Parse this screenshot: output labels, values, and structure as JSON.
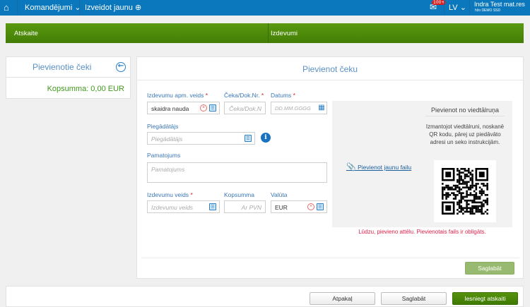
{
  "nav": {
    "menu1": "Komandējumi",
    "menu2": "Izveidot jaunu",
    "badge": "100+",
    "lang": "LV",
    "user_name": "Indra Test mat.res",
    "user_org": "hžo DEMO SSD"
  },
  "steps": [
    "Atskaite",
    "Izdevumi"
  ],
  "left": {
    "title": "Pievienotie čeki",
    "total": "Kopsumma: 0,00 EUR"
  },
  "form": {
    "title": "Pievienot čeku",
    "pay_type_label": "Izdevumu apm. veids",
    "pay_type_value": "skaidra nauda",
    "doc_label": "Čeka/Dok.Nr.",
    "doc_placeholder": "Čeka/Dok.N",
    "date_label": "Datums",
    "date_placeholder": "DD.MM.GGGG",
    "supplier_label": "Piegādātājs",
    "supplier_placeholder": "Piegādātājs",
    "reason_label": "Pamatojums",
    "reason_placeholder": "Pamatojums",
    "exp_type_label": "Izdevumu veids",
    "exp_type_placeholder": "Izdevumu veids",
    "sum_label": "Kopsumma",
    "sum_placeholder": "Ar PVN",
    "cur_label": "Valūta",
    "cur_value": "EUR",
    "required_mark": "*",
    "attach_link": "Pievienot jaunu failu",
    "phone_title": "Pievienot no viedtālruņa",
    "phone_text": "Izmantojot viedtālruni, noskanē QR kodu, pārej uz piedāvāto adresi un seko instrukcijām.",
    "error": "Lūdzu, pievieno attēlu. Pievienotais fails ir obligāts.",
    "save": "Saglabāt"
  },
  "footer": {
    "back": "Atpakaļ",
    "save": "Saglabāt",
    "submit": "Iesniegt atskaiti"
  },
  "colors": {
    "nav": "#0b78be",
    "green": "#4a8a08",
    "error": "#e0204a"
  }
}
